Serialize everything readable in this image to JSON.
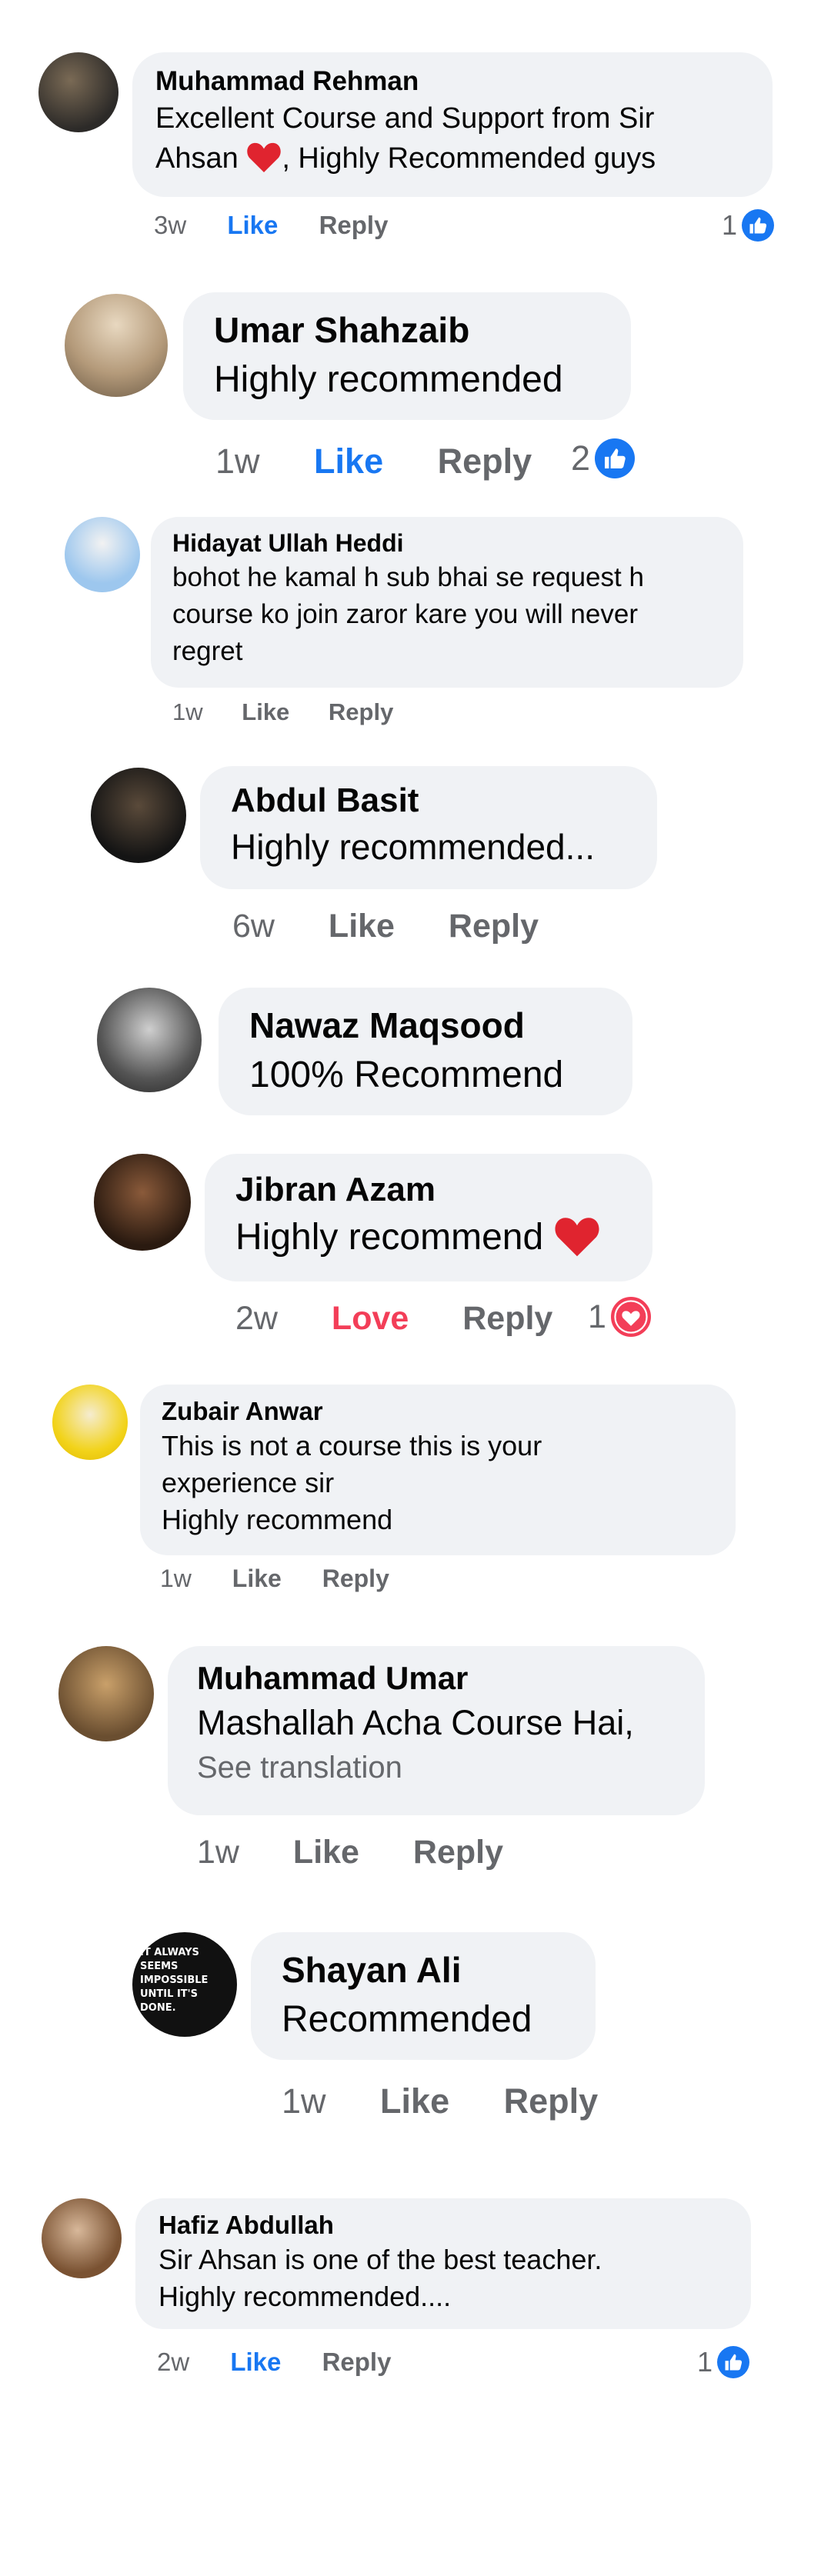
{
  "colors": {
    "like_blue": "#1877f2",
    "love_red": "#f33e58",
    "bubble_bg": "#f0f2f5",
    "meta_gray": "#65676b"
  },
  "comments": [
    {
      "name": "Muhammad Rehman",
      "line1": "Excellent Course and Support from Sir",
      "line2a": "Ahsan",
      "heart": "heart-emoji",
      "line2b": ", Highly Recommended guys",
      "time": "3w",
      "like": "Like",
      "reply": "Reply",
      "reaction_count": "1",
      "reaction_icon": "like-icon"
    },
    {
      "name": "Umar Shahzaib",
      "lines": [
        "Highly recommended"
      ],
      "time": "1w",
      "like": "Like",
      "reply": "Reply",
      "reaction_count": "2",
      "reaction_icon": "like-icon"
    },
    {
      "name": "Hidayat Ullah Heddi",
      "lines": [
        "bohot he kamal h sub bhai se request h",
        "course ko join zaror kare you will never",
        "regret"
      ],
      "time": "1w",
      "like": "Like",
      "reply": "Reply"
    },
    {
      "name": "Abdul Basit",
      "lines": [
        "Highly recommended..."
      ],
      "time": "6w",
      "like": "Like",
      "reply": "Reply"
    },
    {
      "name": "Nawaz Maqsood",
      "lines": [
        "100% Recommend"
      ]
    },
    {
      "name": "Jibran Azam",
      "line1": "Highly recommend",
      "heart": "heart-emoji",
      "time": "2w",
      "love": "Love",
      "reply": "Reply",
      "reaction_count": "1",
      "reaction_icon": "love-icon"
    },
    {
      "name": "Zubair Anwar",
      "lines": [
        "This is not a course this is your",
        "experience sir",
        "Highly recommend"
      ],
      "time": "1w",
      "like": "Like",
      "reply": "Reply"
    },
    {
      "name": "Muhammad Umar",
      "lines": [
        "Mashallah Acha Course Hai,"
      ],
      "see_translation": "See translation",
      "time": "1w",
      "like": "Like",
      "reply": "Reply"
    },
    {
      "name": "Shayan Ali",
      "lines": [
        "Recommended"
      ],
      "avatar_text": [
        "IT ALWAYS",
        "SEEMS",
        "IMPOSSIBLE",
        "UNTIL IT'S",
        "DONE."
      ],
      "time": "1w",
      "like": "Like",
      "reply": "Reply"
    },
    {
      "name": "Hafiz Abdullah",
      "lines": [
        "Sir Ahsan is one of the best teacher.",
        "Highly recommended...."
      ],
      "time": "2w",
      "like": "Like",
      "reply": "Reply",
      "reaction_count": "1",
      "reaction_icon": "like-icon"
    }
  ]
}
